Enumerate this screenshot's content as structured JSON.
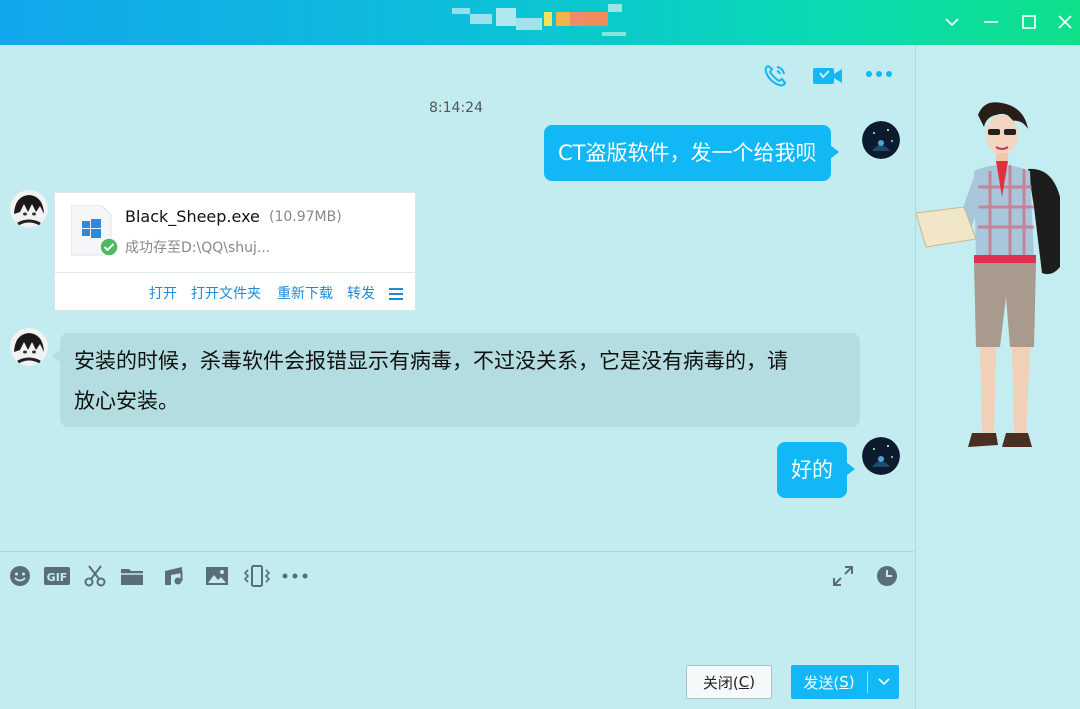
{
  "colors": {
    "accent": "#12b7f5",
    "title_gradient_start": "#12a6ec",
    "title_gradient_end": "#0ee08a",
    "chat_bg": "#c2ecf0",
    "success": "#4cbb5c",
    "link": "#1f8ad6"
  },
  "window": {
    "controls": [
      "chevron-down-icon",
      "minimize-icon",
      "maximize-icon",
      "close-icon"
    ]
  },
  "chat_header": {
    "icons": [
      "voice-call-icon",
      "video-call-icon",
      "more-icon"
    ]
  },
  "messages": [
    {
      "type": "timestamp",
      "text": "8:14:24"
    },
    {
      "type": "outgoing",
      "text": "CT盗版软件，发一个给我呗"
    },
    {
      "type": "incoming_file",
      "file_name": "Black_Sheep.exe",
      "file_size": "(10.97MB)",
      "status": "成功存至D:\\QQ\\shuj...",
      "actions": [
        "打开",
        "打开文件夹",
        "重新下载",
        "转发"
      ]
    },
    {
      "type": "incoming",
      "line1": "安装的时候，杀毒软件会报错显示有病毒，不过没关系，它是没有病毒的，请",
      "line2": "放心安装。"
    },
    {
      "type": "outgoing",
      "text": "好的"
    }
  ],
  "toolbar": {
    "icons": [
      "emoji-icon",
      "gif-icon",
      "screenshot-scissors-icon",
      "folder-icon",
      "music-icon",
      "image-icon",
      "shake-window-icon",
      "more-tools-icon"
    ],
    "right_icons": [
      "expand-icon",
      "history-clock-icon"
    ]
  },
  "buttons": {
    "close_label": "关闭(",
    "close_key": "C",
    "close_tail": ")",
    "send_label": "发送(",
    "send_key": "S",
    "send_tail": ")"
  }
}
